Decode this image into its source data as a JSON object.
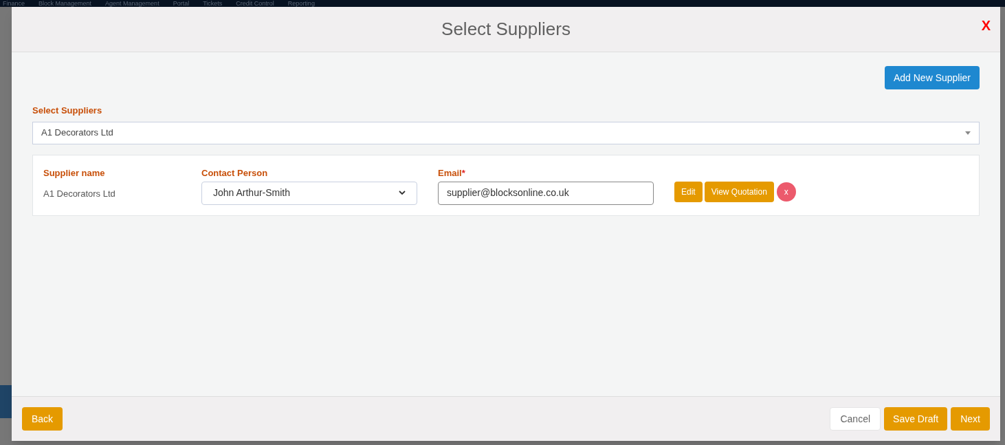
{
  "top_nav": {
    "items": [
      {
        "label": "Finance"
      },
      {
        "label": "Block Management"
      },
      {
        "label": "Agent Management"
      },
      {
        "label": "Portal"
      },
      {
        "label": "Tickets"
      },
      {
        "label": "Credit Control"
      },
      {
        "label": "Reporting"
      }
    ]
  },
  "modal": {
    "title": "Select Suppliers",
    "close": "X",
    "add_button": "Add New Supplier",
    "select_label": "Select Suppliers",
    "select_value": "A1 Decorators Ltd",
    "supplier_columns": [
      "Supplier name",
      "Contact Person",
      "Email"
    ],
    "required_mark": "*",
    "suppliers": [
      {
        "name": "A1 Decorators Ltd",
        "contact": "John Arthur-Smith",
        "email": "supplier@blocksonline.co.uk",
        "actions": [
          "Edit",
          "View Quotation"
        ],
        "remove": "x"
      }
    ],
    "footer": {
      "back": "Back",
      "cancel": "Cancel",
      "save_draft": "Save Draft",
      "next": "Next"
    }
  }
}
